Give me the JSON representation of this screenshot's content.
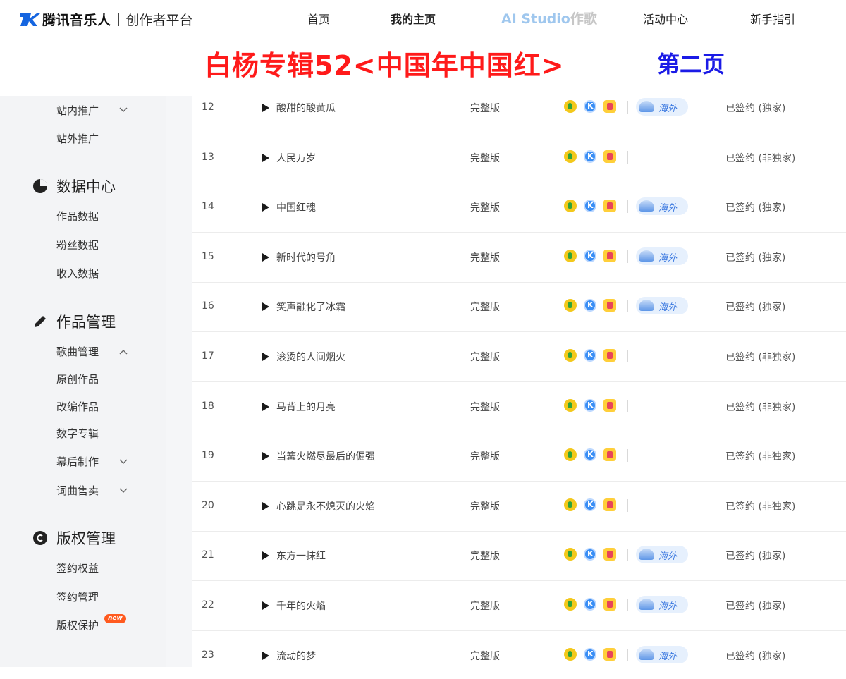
{
  "header": {
    "brand": "腾讯音乐人",
    "subtitle": "创作者平台",
    "nav": {
      "home": "首页",
      "my_home": "我的主页",
      "ai_studio_part1": "AI Studio",
      "ai_studio_part2": "作歌",
      "activity": "活动中心",
      "guide": "新手指引"
    }
  },
  "banner": {
    "title": "白杨专辑52<中国年中国红>",
    "page_label": "第二页"
  },
  "sidebar": {
    "promo_in": "站内推广",
    "promo_out": "站外推广",
    "data_center": "数据中心",
    "works_data": "作品数据",
    "fans_data": "粉丝数据",
    "income_data": "收入数据",
    "works_mgmt": "作品管理",
    "song_mgmt": "歌曲管理",
    "original": "原创作品",
    "adapted": "改编作品",
    "digital_album": "数字专辑",
    "post_production": "幕后制作",
    "lyric_sale": "词曲售卖",
    "copyright_mgmt": "版权管理",
    "sign_rights": "签约权益",
    "sign_mgmt": "签约管理",
    "copyright_protect": "版权保护",
    "new_badge": "new"
  },
  "colors": {
    "banner_title": "#ff1a1a",
    "banner_page": "#1b1be6",
    "overseas_text": "#3a78e0"
  },
  "songs": [
    {
      "num": "12",
      "name": "酸甜的酸黄瓜",
      "version": "完整版",
      "overseas": "海外",
      "status": "已签约 (独家)"
    },
    {
      "num": "13",
      "name": "人民万岁",
      "version": "完整版",
      "overseas": "",
      "status": "已签约 (非独家)"
    },
    {
      "num": "14",
      "name": "中国红魂",
      "version": "完整版",
      "overseas": "海外",
      "status": "已签约 (独家)"
    },
    {
      "num": "15",
      "name": "新时代的号角",
      "version": "完整版",
      "overseas": "海外",
      "status": "已签约 (独家)"
    },
    {
      "num": "16",
      "name": "笑声融化了冰霜",
      "version": "完整版",
      "overseas": "海外",
      "status": "已签约 (独家)"
    },
    {
      "num": "17",
      "name": "滚烫的人间烟火",
      "version": "完整版",
      "overseas": "",
      "status": "已签约 (非独家)"
    },
    {
      "num": "18",
      "name": "马背上的月亮",
      "version": "完整版",
      "overseas": "",
      "status": "已签约 (非独家)"
    },
    {
      "num": "19",
      "name": "当篝火燃尽最后的倔强",
      "version": "完整版",
      "overseas": "",
      "status": "已签约 (非独家)"
    },
    {
      "num": "20",
      "name": "心跳是永不熄灭的火焰",
      "version": "完整版",
      "overseas": "",
      "status": "已签约 (非独家)"
    },
    {
      "num": "21",
      "name": "东方一抹红",
      "version": "完整版",
      "overseas": "海外",
      "status": "已签约 (独家)"
    },
    {
      "num": "22",
      "name": "千年的火焰",
      "version": "完整版",
      "overseas": "海外",
      "status": "已签约 (独家)"
    },
    {
      "num": "23",
      "name": "流动的梦",
      "version": "完整版",
      "overseas": "海外",
      "status": "已签约 (独家)"
    }
  ]
}
